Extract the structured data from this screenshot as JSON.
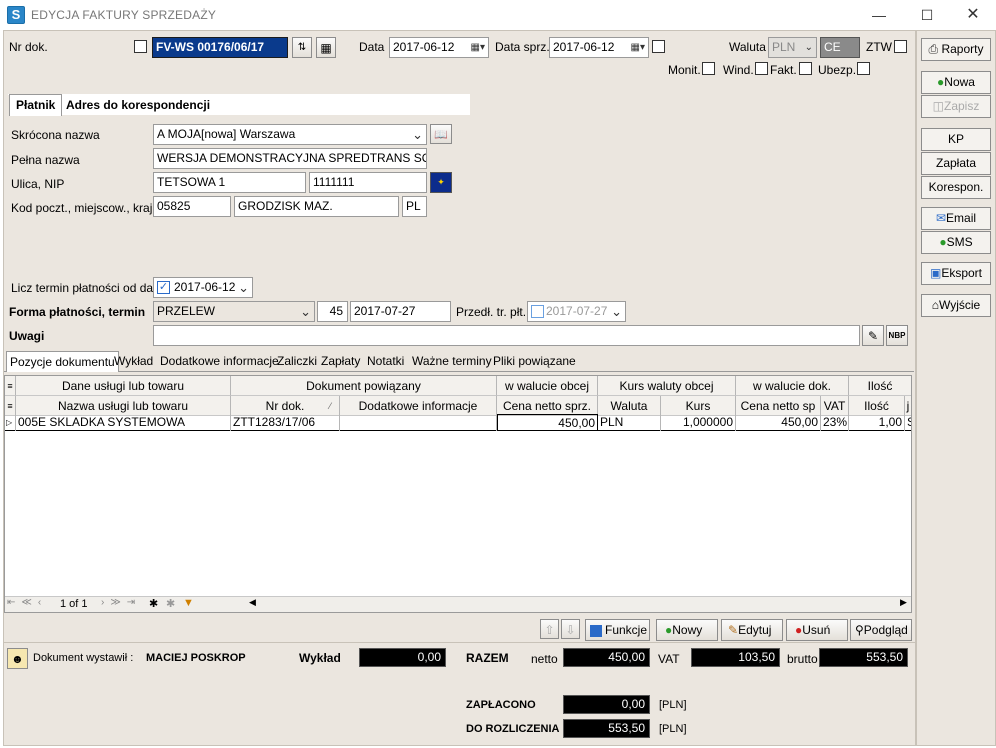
{
  "window": {
    "title": "EDYCJA FAKTURY SPRZEDAŻY"
  },
  "header": {
    "nr_dok_label": "Nr dok.",
    "nr_dok_value": "FV-WS 00176/06/17",
    "data_label": "Data",
    "data_value": "2017-06-12",
    "data_sprz_label": "Data sprz.",
    "data_sprz_value": "2017-06-12",
    "waluta_label": "Waluta",
    "waluta_value": "PLN",
    "waluta_code": "CE",
    "ztw_label": "ZTW",
    "monit_label": "Monit.",
    "wind_label": "Wind.",
    "fakt_label": "Fakt.",
    "ubezp_label": "Ubezp."
  },
  "tabs_top": [
    "Płatnik",
    "Adres do korespondencji"
  ],
  "platnik": {
    "skrocona_label": "Skrócona nazwa",
    "skrocona_value": "A MOJA[nowa] Warszawa",
    "pelna_label": "Pełna nazwa",
    "pelna_value": "WERSJA DEMONSTRACYJNA SPREDTRANS SQL",
    "ulica_label": "Ulica, NIP",
    "ulica_value": "TETSOWA 1",
    "nip_value": "1111111",
    "kod_label": "Kod poczt., miejscow., kraj",
    "kod_value": "05825",
    "miejscowosc_value": "GRODZISK MAZ.",
    "kraj_value": "PL"
  },
  "payment": {
    "termin_od_label": "Licz termin płatności od daty",
    "termin_od_value": "2017-06-12",
    "forma_label": "Forma płatności, termin",
    "forma_value": "PRZELEW",
    "dni_value": "45",
    "termin_value": "2017-07-27",
    "przedl_label": "Przedł. tr. płt.",
    "przedl_value": "2017-07-27",
    "uwagi_label": "Uwagi",
    "nbp_label": "NBP"
  },
  "tabs_bottom": [
    "Pozycje dokumentu",
    "Wykład",
    "Dodatkowe informacje",
    "Zaliczki",
    "Zapłaty",
    "Notatki",
    "Ważne terminy",
    "Pliki powiązane"
  ],
  "grid": {
    "groups": [
      "Dane usługi lub towaru",
      "Dokument powiązany",
      "w walucie obcej",
      "Kurs waluty obcej",
      "w walucie dok.",
      "Ilość"
    ],
    "columns": [
      "Nazwa usługi lub towaru",
      "Nr dok.",
      "Dodatkowe informacje",
      "Cena netto sprz.",
      "Waluta",
      "Kurs",
      "Cena netto sp",
      "VAT",
      "Ilość",
      "j"
    ],
    "rows": [
      [
        "005E SKLADKA SYSTEMOWA",
        "ZTT1283/17/06",
        "",
        "450,00",
        "PLN",
        "1,000000",
        "450,00",
        "23%",
        "1,00",
        "S"
      ]
    ],
    "pager": "1 of 1"
  },
  "grid_buttons": {
    "funkcje": "Funkcje",
    "nowy": "Nowy",
    "edytuj": "Edytuj",
    "usun": "Usuń",
    "podglad": "Podgląd"
  },
  "summary": {
    "wystawil_label": "Dokument wystawił :",
    "wystawil_value": "MACIEJ POSKROP",
    "wyklad_label": "Wykład",
    "wyklad_value": "0,00",
    "razem_label": "RAZEM",
    "netto_label": "netto",
    "netto_value": "450,00",
    "vat_label": "VAT",
    "vat_value": "103,50",
    "brutto_label": "brutto",
    "brutto_value": "553,50",
    "zaplacono_label": "ZAPŁACONO",
    "zaplacono_value": "0,00",
    "do_rozliczenia_label": "DO ROZLICZENIA",
    "do_rozliczenia_value": "553,50",
    "currency": "[PLN]"
  },
  "sidebar": {
    "raporty": "Raporty",
    "nowa": "Nowa",
    "zapisz": "Zapisz",
    "kp": "KP",
    "zaplata": "Zapłata",
    "korespon": "Korespon.",
    "email": "Email",
    "sms": "SMS",
    "eksport": "Eksport",
    "wyjscie": "Wyjście"
  }
}
